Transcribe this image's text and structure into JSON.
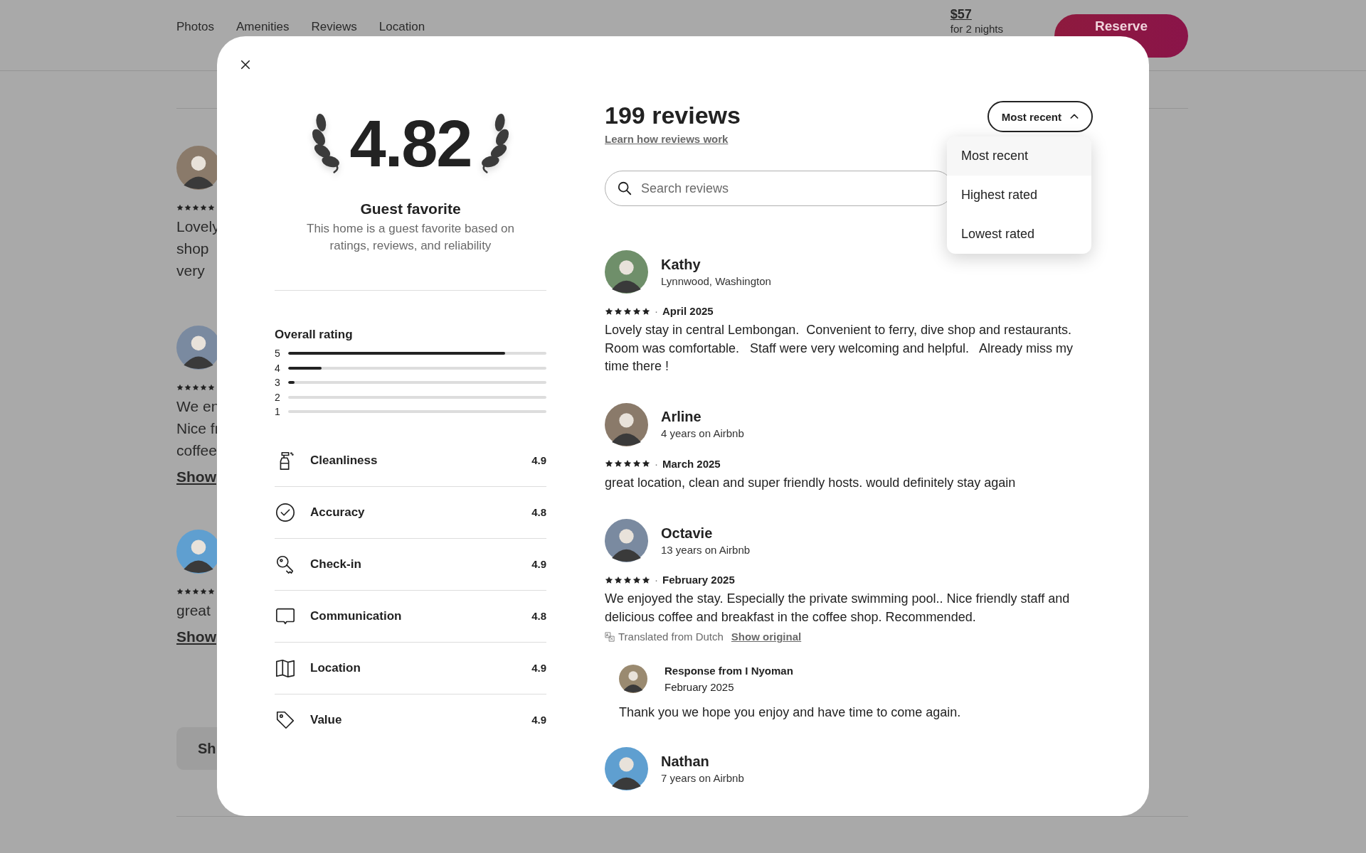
{
  "background": {
    "nav_tabs": [
      "Photos",
      "Amenities",
      "Reviews",
      "Location"
    ],
    "price": "$57",
    "price_note": "for 2 nights",
    "reserve_button": "Reserve",
    "reviews": [
      {
        "stars": 5,
        "lines": [
          "Lovely",
          "shop",
          "very"
        ]
      },
      {
        "stars": 5,
        "lines": [
          "We en",
          "Nice fr",
          "coffee"
        ],
        "show_more": "Show"
      },
      {
        "stars": 5,
        "lines": [
          "great"
        ],
        "show_more": "Show"
      }
    ],
    "show_all_button": "Sh"
  },
  "modal": {
    "score": "4.82",
    "badge_title": "Guest favorite",
    "badge_text": "This home is a guest favorite based on ratings, reviews, and reliability",
    "overall_rating": {
      "label": "Overall rating",
      "bars": [
        {
          "label": "5",
          "level": 0.84
        },
        {
          "label": "4",
          "level": 0.13
        },
        {
          "label": "3",
          "level": 0.025
        },
        {
          "label": "2",
          "level": 0
        },
        {
          "label": "1",
          "level": 0
        }
      ]
    },
    "categories": [
      {
        "kind": "cleanliness",
        "label": "Cleanliness",
        "score": "4.9"
      },
      {
        "kind": "accuracy",
        "label": "Accuracy",
        "score": "4.8"
      },
      {
        "kind": "checkin",
        "label": "Check-in",
        "score": "4.9"
      },
      {
        "kind": "communication",
        "label": "Communication",
        "score": "4.8"
      },
      {
        "kind": "location",
        "label": "Location",
        "score": "4.9"
      },
      {
        "kind": "value",
        "label": "Value",
        "score": "4.9"
      }
    ],
    "reviews_count": "199 reviews",
    "learn_link": "Learn how reviews work",
    "sort": {
      "label": "Most recent",
      "expanded": true,
      "options": [
        {
          "label": "Most recent",
          "selected": true
        },
        {
          "label": "Highest rated",
          "selected": false
        },
        {
          "label": "Lowest rated",
          "selected": false
        }
      ]
    },
    "search": {
      "placeholder": "Search reviews"
    },
    "reviews": [
      {
        "name": "Kathy",
        "subtitle": "Lynnwood, Washington",
        "stars": 5,
        "separator": "·",
        "date": "April 2025",
        "text": "Lovely stay in central Lembongan.  Convenient to ferry, dive shop and restaurants.  Room was comfortable.   Staff were very welcoming and helpful.   Already miss my time there !"
      },
      {
        "name": "Arline",
        "subtitle": "4 years on Airbnb",
        "stars": 5,
        "separator": "·",
        "date": "March 2025",
        "text": "great location, clean and super friendly hosts. would definitely stay again"
      },
      {
        "name": "Octavie",
        "subtitle": "13 years on Airbnb",
        "stars": 5,
        "separator": "·",
        "date": "February 2025",
        "text": "We enjoyed the stay. Especially the private swimming pool.. Nice friendly staff and delicious coffee and breakfast in the coffee shop. Recommended.",
        "translation": {
          "note": "Translated from Dutch",
          "link": "Show original"
        },
        "response": {
          "title": "Response from I Nyoman",
          "date": "February 2025",
          "text": "Thank you we hope you enjoy and have time to come again."
        }
      },
      {
        "name": "Nathan",
        "subtitle": "7 years on Airbnb"
      }
    ]
  }
}
